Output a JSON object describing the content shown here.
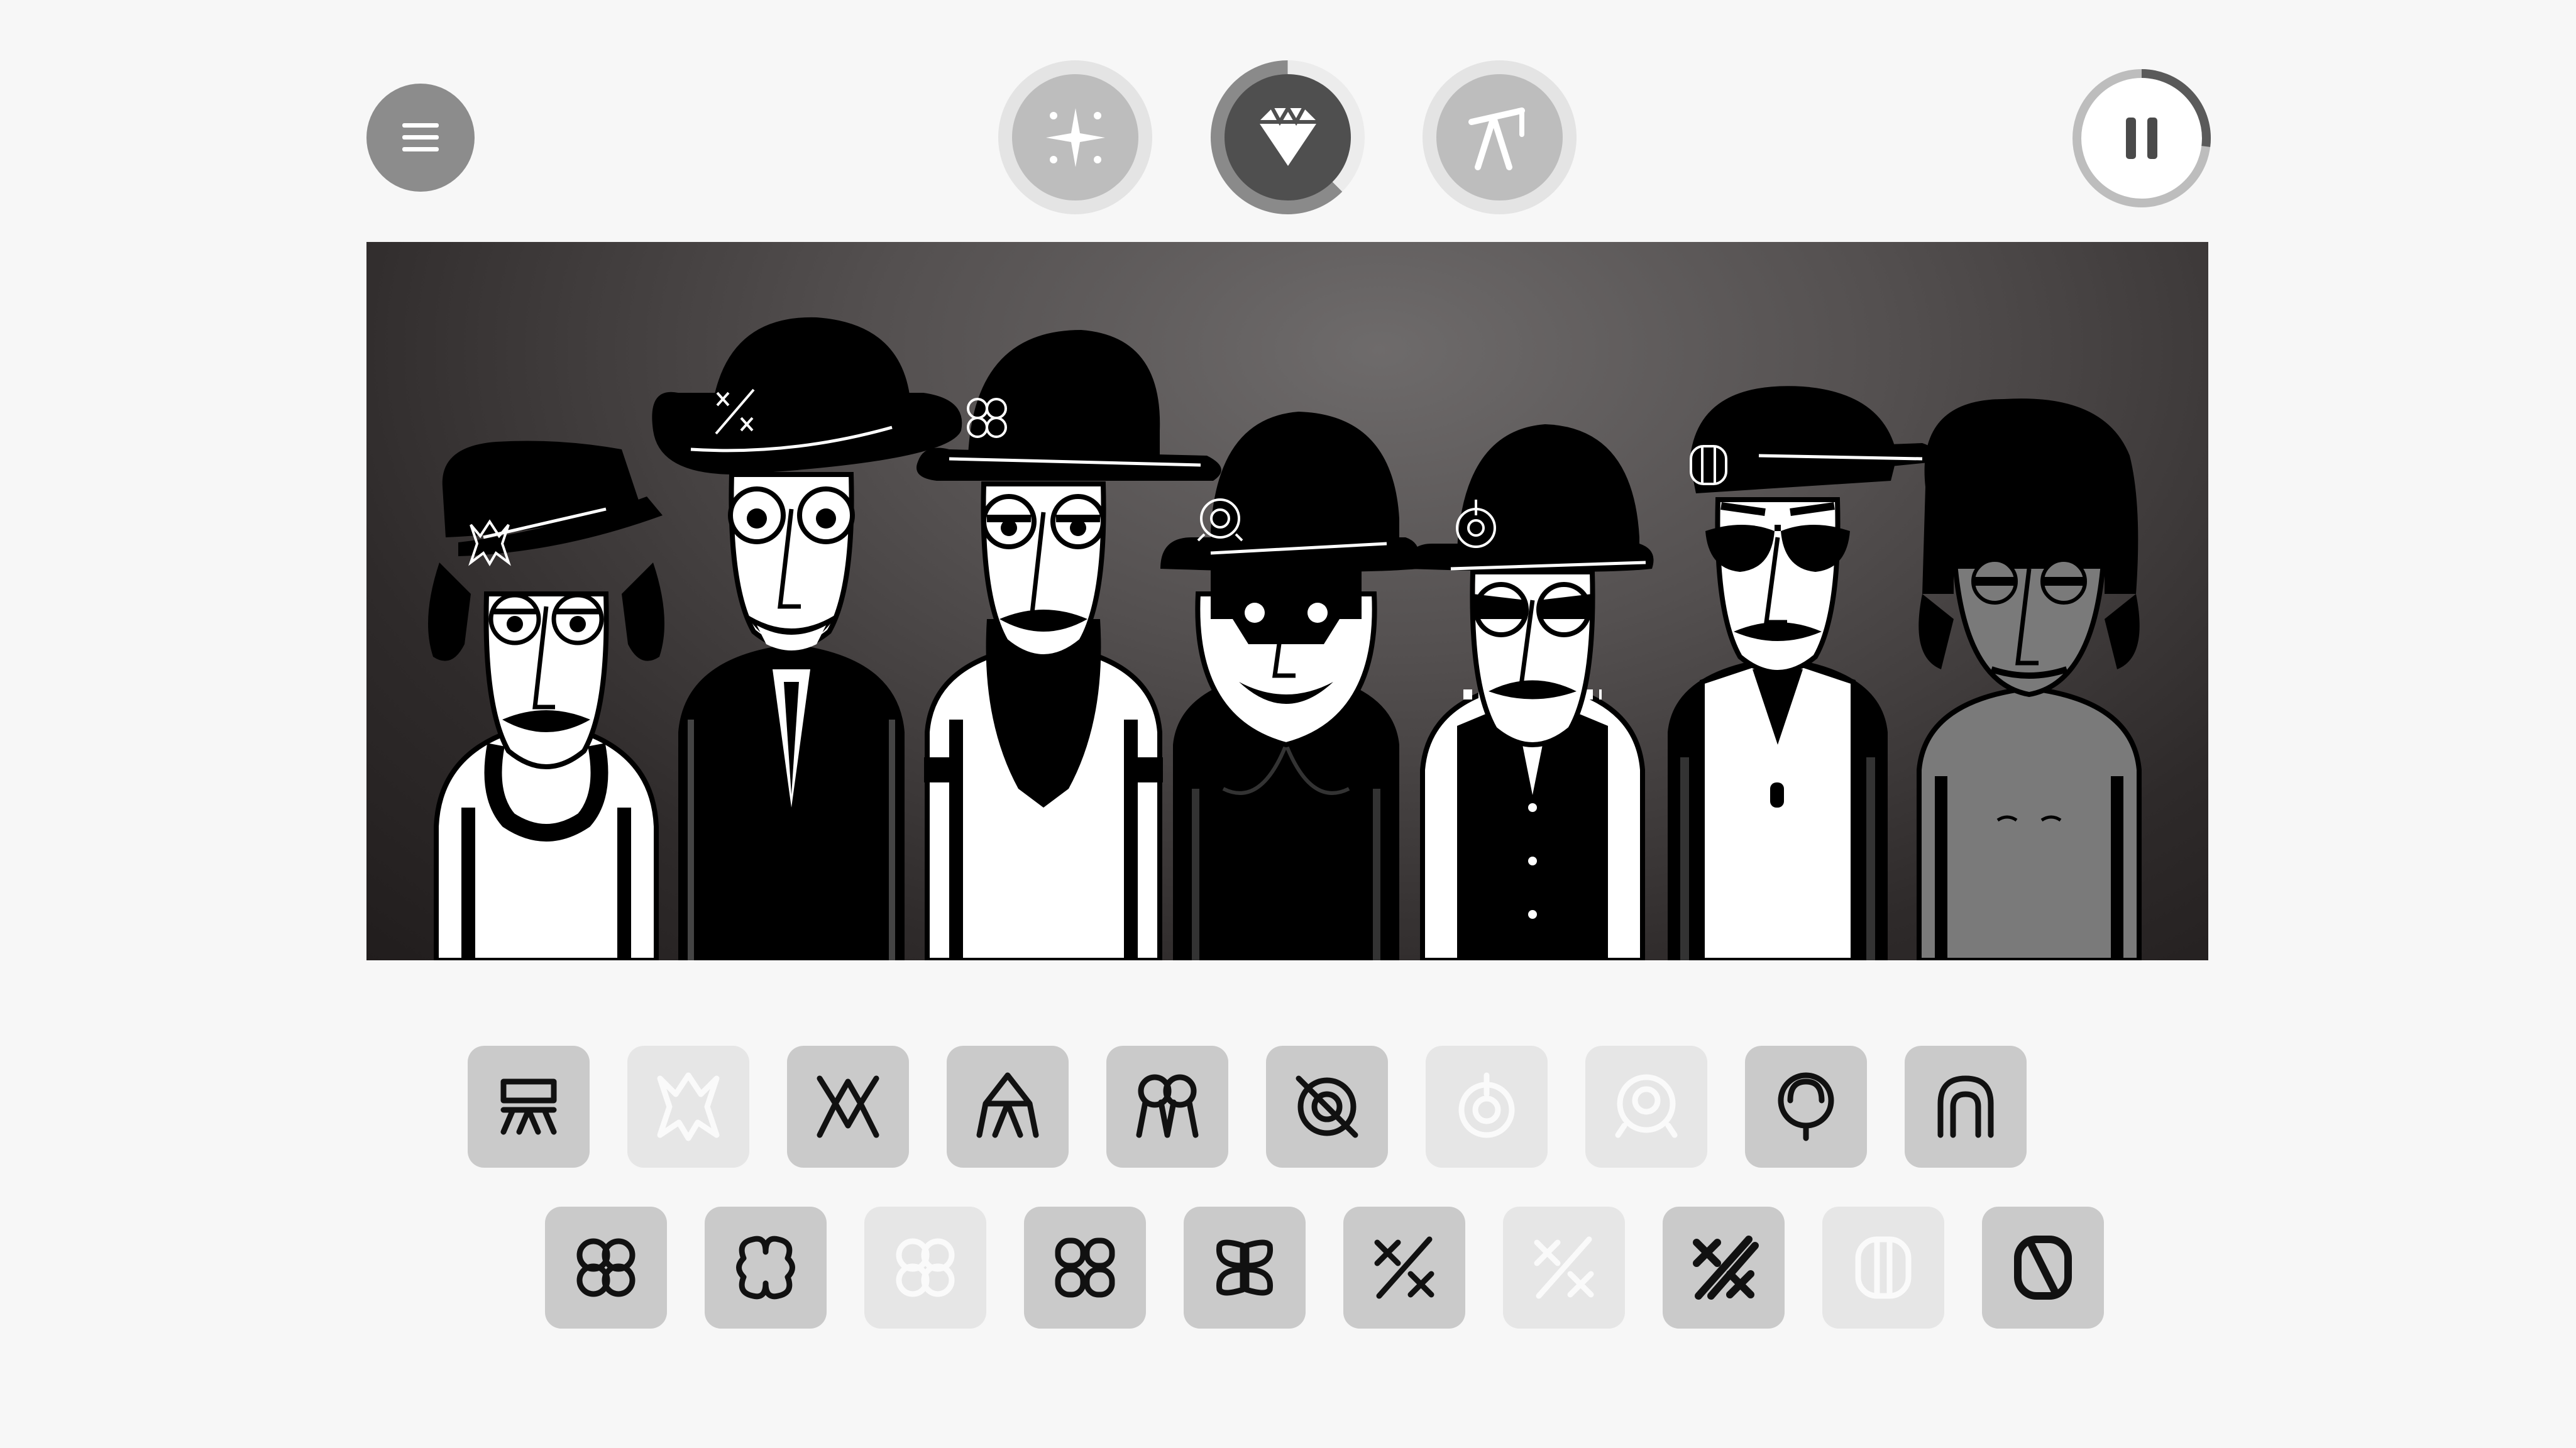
{
  "controls": {
    "menu_icon": "hamburger-menu-icon",
    "modes": [
      {
        "id": "normal",
        "icon": "sparkle-icon",
        "active": false
      },
      {
        "id": "dark",
        "icon": "diamond-icon",
        "active": true
      },
      {
        "id": "bonus",
        "icon": "crane-icon",
        "active": false
      }
    ],
    "pause_icon": "pause-icon",
    "progress": 0.27
  },
  "colors": {
    "background": "#f7f7f7",
    "tile": "#cacaca",
    "tile_used": "#e6e6e6",
    "active_mode": "#4f4f4f",
    "inactive_mode": "#bdbdbd",
    "stage_dark": "#211d1d"
  },
  "stage": {
    "characters": [
      {
        "slot": 1,
        "hat_symbol": "burst",
        "skin": "white",
        "clothes": "white-jacket"
      },
      {
        "slot": 2,
        "hat_symbol": "percent",
        "skin": "white",
        "clothes": "black-suit"
      },
      {
        "slot": 3,
        "hat_symbol": "clover",
        "skin": "white",
        "clothes": "white-coat"
      },
      {
        "slot": 4,
        "hat_symbol": "ring",
        "skin": "white",
        "clothes": "black-hoodie"
      },
      {
        "slot": 5,
        "hat_symbol": "power",
        "skin": "white",
        "clothes": "varsity-vest"
      },
      {
        "slot": 6,
        "hat_symbol": "pill",
        "skin": "white",
        "clothes": "polo"
      },
      {
        "slot": 7,
        "hat_symbol": "none",
        "skin": "grey",
        "clothes": "bare"
      }
    ]
  },
  "sound_icons": {
    "row_1": [
      {
        "icon": "beat-table-icon",
        "used": false
      },
      {
        "icon": "beat-burst-icon",
        "used": true
      },
      {
        "icon": "beat-crown-icon",
        "used": false
      },
      {
        "icon": "beat-peak-icon",
        "used": false
      },
      {
        "icon": "beat-loops-icon",
        "used": false
      },
      {
        "icon": "effect-slashed-ring-icon",
        "used": false
      },
      {
        "icon": "effect-power-icon",
        "used": true
      },
      {
        "icon": "effect-target-icon",
        "used": true
      },
      {
        "icon": "effect-bulb-icon",
        "used": false
      },
      {
        "icon": "effect-arch-icon",
        "used": false
      }
    ],
    "row_2": [
      {
        "icon": "melody-clover-icon",
        "used": false
      },
      {
        "icon": "melody-clover-alt-icon",
        "used": false
      },
      {
        "icon": "melody-clover-faded-icon",
        "used": true
      },
      {
        "icon": "melody-quad-icon",
        "used": false
      },
      {
        "icon": "melody-leaf-icon",
        "used": false
      },
      {
        "icon": "voice-percent-icon",
        "used": false
      },
      {
        "icon": "voice-percent-faded-icon",
        "used": true
      },
      {
        "icon": "voice-percent-bold-icon",
        "used": false
      },
      {
        "icon": "voice-pill-icon",
        "used": true
      },
      {
        "icon": "voice-pill-bold-icon",
        "used": false
      }
    ]
  }
}
